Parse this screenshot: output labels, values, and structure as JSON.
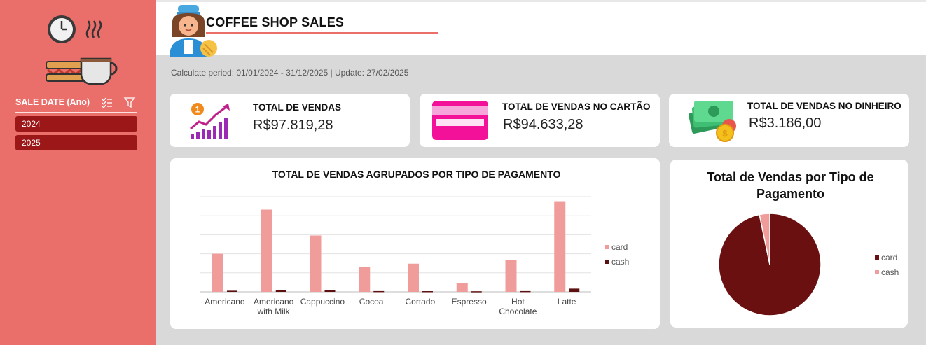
{
  "header": {
    "title": "COFFEE SHOP SALES"
  },
  "period_text": "Calculate period: 01/01/2024 - 31/12/2025 | Update: 27/02/2025",
  "slicer": {
    "title": "SALE DATE (Ano)",
    "items": [
      "2024",
      "2025"
    ]
  },
  "kpis": [
    {
      "label": "TOTAL DE VENDAS",
      "value": "R$97.819,28",
      "icon": "growth-chart-icon"
    },
    {
      "label": "TOTAL DE VENDAS NO CARTÃO",
      "value": "R$94.633,28",
      "icon": "credit-card-icon"
    },
    {
      "label": "TOTAL DE VENDAS NO DINHEIRO",
      "value": "R$3.186,00",
      "icon": "cash-money-icon"
    }
  ],
  "colors": {
    "sidebar": "#ea6e6a",
    "slicer_item": "#9c1818",
    "card_series": "#f09c9a",
    "cash_series": "#5c1010",
    "pie_card": "#6b1010",
    "pie_cash": "#f09c9a"
  },
  "chart_data": [
    {
      "type": "bar",
      "title": "TOTAL DE VENDAS AGRUPADOS POR TIPO DE PAGAMENTO",
      "categories": [
        "Americano",
        "Americano with Milk",
        "Cappuccino",
        "Cocoa",
        "Cortado",
        "Espresso",
        "Hot Chocolate",
        "Latte"
      ],
      "series": [
        {
          "name": "card",
          "values": [
            10000,
            21600,
            14800,
            6500,
            7400,
            2200,
            8300,
            23800
          ]
        },
        {
          "name": "cash",
          "values": [
            300,
            500,
            450,
            200,
            180,
            150,
            200,
            850
          ]
        }
      ],
      "ylim": [
        0,
        25000
      ],
      "grid": true,
      "legend": "right"
    },
    {
      "type": "pie",
      "title": "Total de Vendas por Tipo de Pagamento",
      "categories": [
        "card",
        "cash"
      ],
      "values": [
        94633.28,
        3186.0
      ],
      "legend": "right"
    }
  ]
}
